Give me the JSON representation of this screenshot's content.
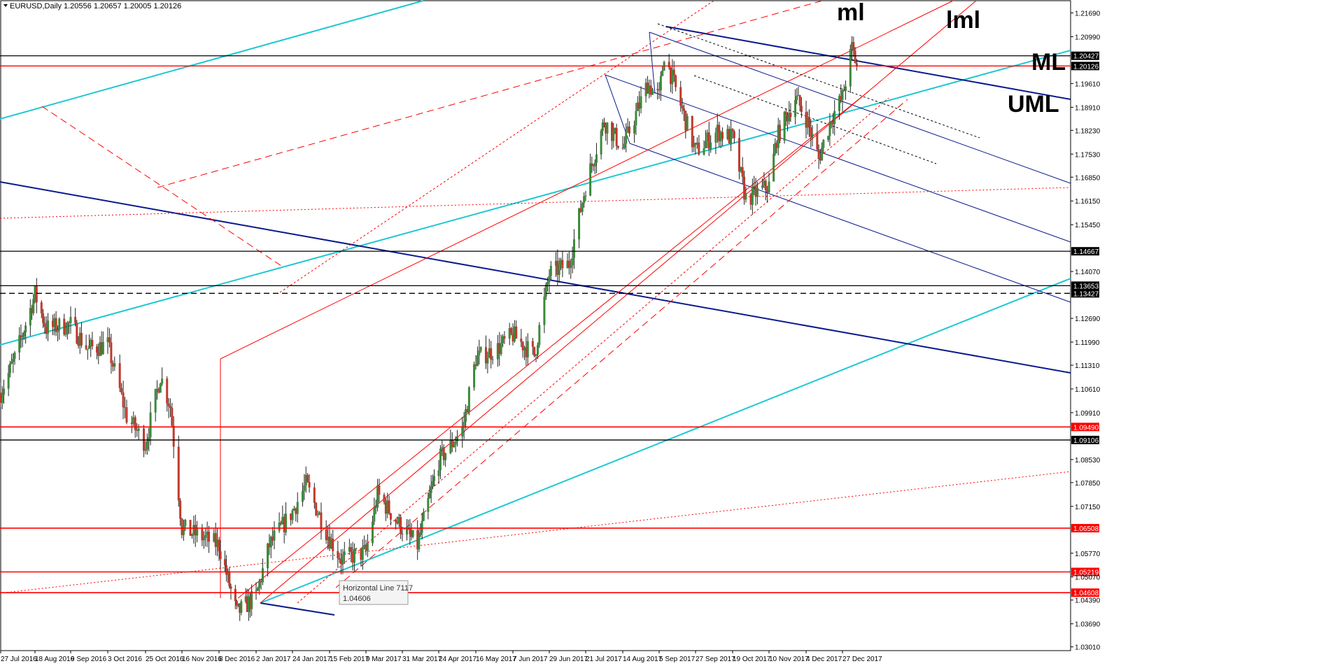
{
  "header": {
    "title": "EURUSD,Daily  1.20556 1.20657 1.20005 1.20126"
  },
  "chart_data": {
    "type": "candlestick",
    "symbol": "EURUSD",
    "timeframe": "Daily",
    "ohlc_last": {
      "open": 1.20556,
      "high": 1.20657,
      "low": 1.20005,
      "close": 1.20126
    },
    "ylim": [
      1.029,
      1.2205
    ],
    "y_ticks": [
      "1.21690",
      "1.20990",
      "1.19610",
      "1.18910",
      "1.18230",
      "1.17530",
      "1.16850",
      "1.16150",
      "1.15450",
      "1.14070",
      "1.12690",
      "1.11990",
      "1.11310",
      "1.10610",
      "1.09910",
      "1.08530",
      "1.07850",
      "1.07150",
      "1.05770",
      "1.05070",
      "1.04390",
      "1.03690",
      "1.03010"
    ],
    "x_ticks": [
      "27 Jul 2016",
      "18 Aug 2016",
      "9 Sep 2016",
      "3 Oct 2016",
      "25 Oct 2016",
      "16 Nov 2016",
      "8 Dec 2016",
      "2 Jan 2017",
      "24 Jan 2017",
      "15 Feb 2017",
      "9 Mar 2017",
      "31 Mar 2017",
      "24 Apr 2017",
      "16 May 2017",
      "7 Jun 2017",
      "29 Jun 2017",
      "21 Jul 2017",
      "14 Aug 2017",
      "5 Sep 2017",
      "27 Sep 2017",
      "19 Oct 2017",
      "10 Nov 2017",
      "4 Dec 2017",
      "27 Dec 2017"
    ],
    "price_path": [
      [
        "27 Jul 2016",
        1.105
      ],
      [
        "5 Aug 2016",
        1.115
      ],
      [
        "18 Aug 2016",
        1.134
      ],
      [
        "25 Aug 2016",
        1.124
      ],
      [
        "9 Sep 2016",
        1.125
      ],
      [
        "20 Sep 2016",
        1.118
      ],
      [
        "3 Oct 2016",
        1.119
      ],
      [
        "14 Oct 2016",
        1.098
      ],
      [
        "25 Oct 2016",
        1.09
      ],
      [
        "3 Nov 2016",
        1.11
      ],
      [
        "9 Nov 2016",
        1.101
      ],
      [
        "16 Nov 2016",
        1.065
      ],
      [
        "30 Nov 2016",
        1.062
      ],
      [
        "8 Dec 2016",
        1.06
      ],
      [
        "20 Dec 2016",
        1.04
      ],
      [
        "2 Jan 2017",
        1.045
      ],
      [
        "10 Jan 2017",
        1.06
      ],
      [
        "24 Jan 2017",
        1.07
      ],
      [
        "1 Feb 2017",
        1.078
      ],
      [
        "15 Feb 2017",
        1.062
      ],
      [
        "22 Feb 2017",
        1.056
      ],
      [
        "9 Mar 2017",
        1.058
      ],
      [
        "16 Mar 2017",
        1.075
      ],
      [
        "31 Mar 2017",
        1.065
      ],
      [
        "10 Apr 2017",
        1.06
      ],
      [
        "24 Apr 2017",
        1.085
      ],
      [
        "8 May 2017",
        1.094
      ],
      [
        "16 May 2017",
        1.115
      ],
      [
        "29 May 2017",
        1.118
      ],
      [
        "7 Jun 2017",
        1.122
      ],
      [
        "20 Jun 2017",
        1.116
      ],
      [
        "29 Jun 2017",
        1.14
      ],
      [
        "11 Jul 2017",
        1.143
      ],
      [
        "21 Jul 2017",
        1.166
      ],
      [
        "2 Aug 2017",
        1.185
      ],
      [
        "14 Aug 2017",
        1.177
      ],
      [
        "29 Aug 2017",
        1.196
      ],
      [
        "5 Sep 2017",
        1.192
      ],
      [
        "8 Sep 2017",
        1.205
      ],
      [
        "27 Sep 2017",
        1.176
      ],
      [
        "10 Oct 2017",
        1.182
      ],
      [
        "19 Oct 2017",
        1.18
      ],
      [
        "27 Oct 2017",
        1.162
      ],
      [
        "10 Nov 2017",
        1.166
      ],
      [
        "15 Nov 2017",
        1.18
      ],
      [
        "27 Nov 2017",
        1.192
      ],
      [
        "4 Dec 2017",
        1.186
      ],
      [
        "12 Dec 2017",
        1.174
      ],
      [
        "20 Dec 2017",
        1.186
      ],
      [
        "27 Dec 2017",
        1.192
      ],
      [
        "2 Jan 2018",
        1.2065
      ],
      [
        "5 Jan 2018",
        1.2013
      ]
    ],
    "horizontal_levels": [
      {
        "value": 1.20427,
        "label": "1.20427",
        "color": "#000000",
        "style": "solid"
      },
      {
        "value": 1.20126,
        "label": "1.20126",
        "color": "#000000",
        "style": "current"
      },
      {
        "value": 1.14667,
        "label": "1.14667",
        "color": "#000000",
        "style": "solid"
      },
      {
        "value": 1.13653,
        "label": "1.13653",
        "color": "#000000",
        "style": "solid"
      },
      {
        "value": 1.13427,
        "label": "1.13427",
        "color": "#000000",
        "style": "dashed"
      },
      {
        "value": 1.0949,
        "label": "1.09490",
        "color": "#ff0000",
        "style": "solid"
      },
      {
        "value": 1.09106,
        "label": "1.09106",
        "color": "#000000",
        "style": "solid"
      },
      {
        "value": 1.06508,
        "label": "1.06508",
        "color": "#ff0000",
        "style": "solid"
      },
      {
        "value": 1.05219,
        "label": "1.05219",
        "color": "#ff0000",
        "style": "solid"
      },
      {
        "value": 1.04608,
        "label": "1.04608",
        "color": "#ff0000",
        "style": "solid"
      }
    ],
    "annotations": [
      "ml",
      "lml",
      "ML",
      "UML"
    ],
    "tooltip": {
      "title": "Horizontal Line 7117",
      "value": "1.04606"
    },
    "colors": {
      "up_candle": "#3a8a3a",
      "down_candle": "#c0392b",
      "cyan_lines": "#1ec8d0",
      "navy_lines": "#0a1a8c",
      "red_lines": "#ff0000"
    }
  }
}
